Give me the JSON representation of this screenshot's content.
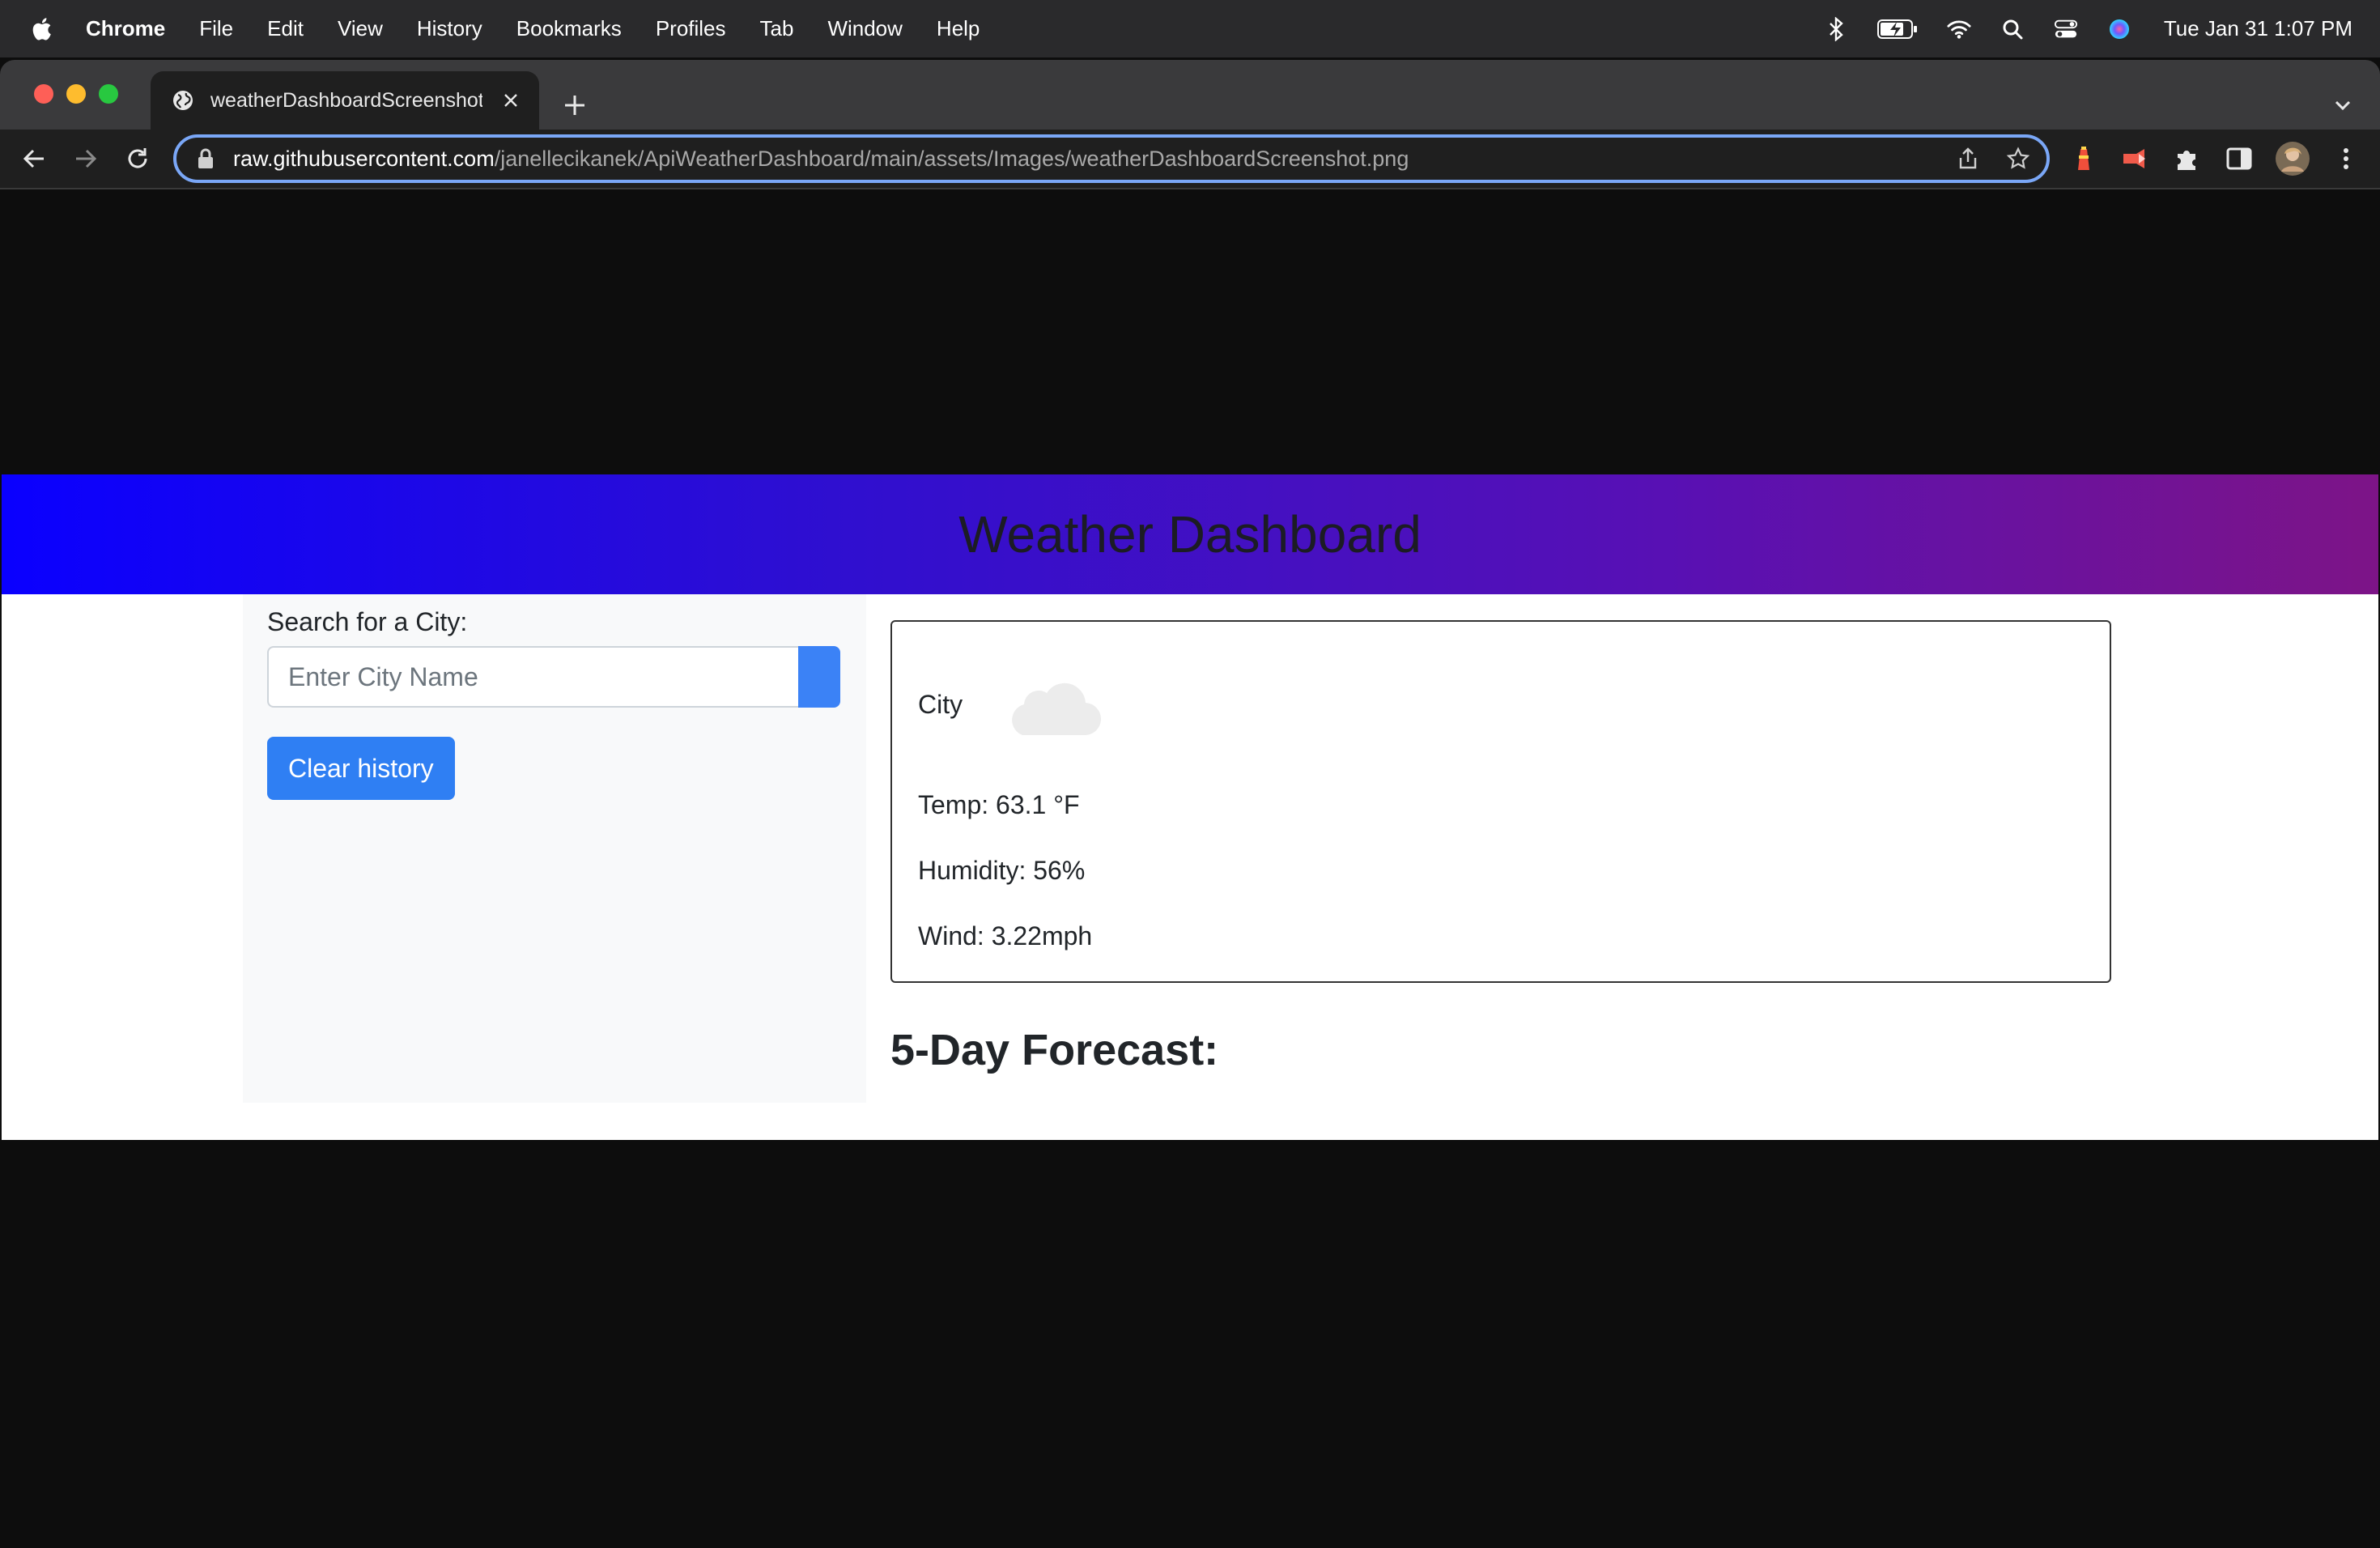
{
  "menubar": {
    "items": [
      "Chrome",
      "File",
      "Edit",
      "View",
      "History",
      "Bookmarks",
      "Profiles",
      "Tab",
      "Window",
      "Help"
    ],
    "clock": "Tue Jan 31  1:07 PM",
    "icons": [
      "apple-icon",
      "bluetooth-icon",
      "battery-icon",
      "wifi-icon",
      "spotlight-icon",
      "control-center-icon",
      "siri-icon"
    ]
  },
  "browser": {
    "tab_title": "weatherDashboardScreenshot.png",
    "url_host": "raw.githubusercontent.com",
    "url_path": "/janellecikanek/ApiWeatherDashboard/main/assets/Images/weatherDashboardScreenshot.png",
    "accent": "#7aa7f7"
  },
  "page": {
    "title": "Weather Dashboard",
    "search_label": "Search for a City:",
    "search_placeholder": "Enter City Name",
    "clear_label": "Clear history",
    "city": "City",
    "temp": "Temp: 63.1 °F",
    "humidity": "Humidity: 56%",
    "wind": "Wind: 3.22mph",
    "forecast_title": "5-Day Forecast:",
    "colors": {
      "banner_start": "#0a00ff",
      "banner_end": "#7d1487",
      "button": "#2f7ff3"
    }
  }
}
